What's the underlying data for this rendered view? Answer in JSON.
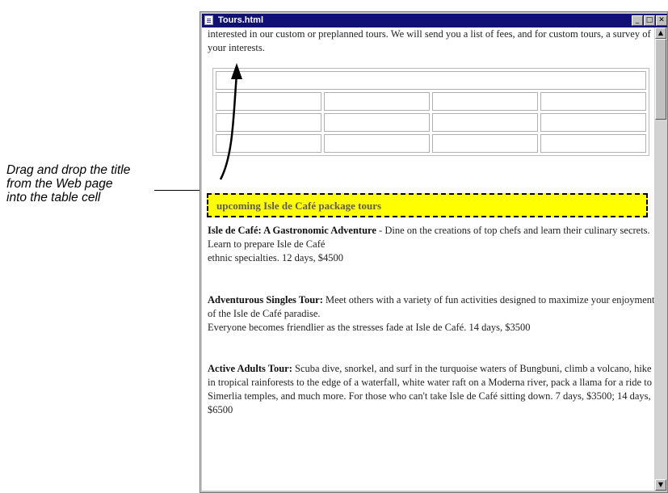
{
  "callout": {
    "lines": [
      "Drag and drop the title",
      "from the Web page",
      "into the table cell"
    ]
  },
  "window": {
    "title": "Tours.html",
    "buttons": {
      "minimize": "_",
      "maximize": "□",
      "close": "✕"
    }
  },
  "content": {
    "intro": "interested in our custom or preplanned tours. We will send you a list of fees, and for custom tours, a survey of your interests.",
    "highlighted_title": "upcoming Isle de Café package tours",
    "tours": [
      {
        "name": "Isle de Café: A Gastronomic Adventure",
        "sep": " - ",
        "text": "Dine on the creations of top chefs and learn their culinary secrets. Learn to prepare Isle de Café",
        "line2": "ethnic specialties. 12 days, $4500"
      },
      {
        "name": "Adventurous Singles Tour:",
        "sep": " ",
        "text": "Meet others with a variety of fun activities designed to maximize your enjoyment of the Isle de Café paradise.",
        "line2": "Everyone becomes friendlier as the stresses fade at Isle de Café. 14 days, $3500"
      },
      {
        "name": "Active Adults Tour:",
        "sep": " ",
        "text": "Scuba dive, snorkel, and surf in the turquoise waters of Bungbuni, climb a volcano, hike in tropical rainforests to the edge of a waterfall, white water raft on a Moderna river, pack a llama for a ride to Simerlia temples, and much more. For those who can't take Isle de Café sitting down. 7 days, $3500; 14 days, $6500",
        "line2": ""
      }
    ]
  },
  "scrollbar": {
    "up": "▲",
    "down": "▼"
  },
  "colors": {
    "titlebar": "#111175",
    "highlight": "#ffff00"
  }
}
